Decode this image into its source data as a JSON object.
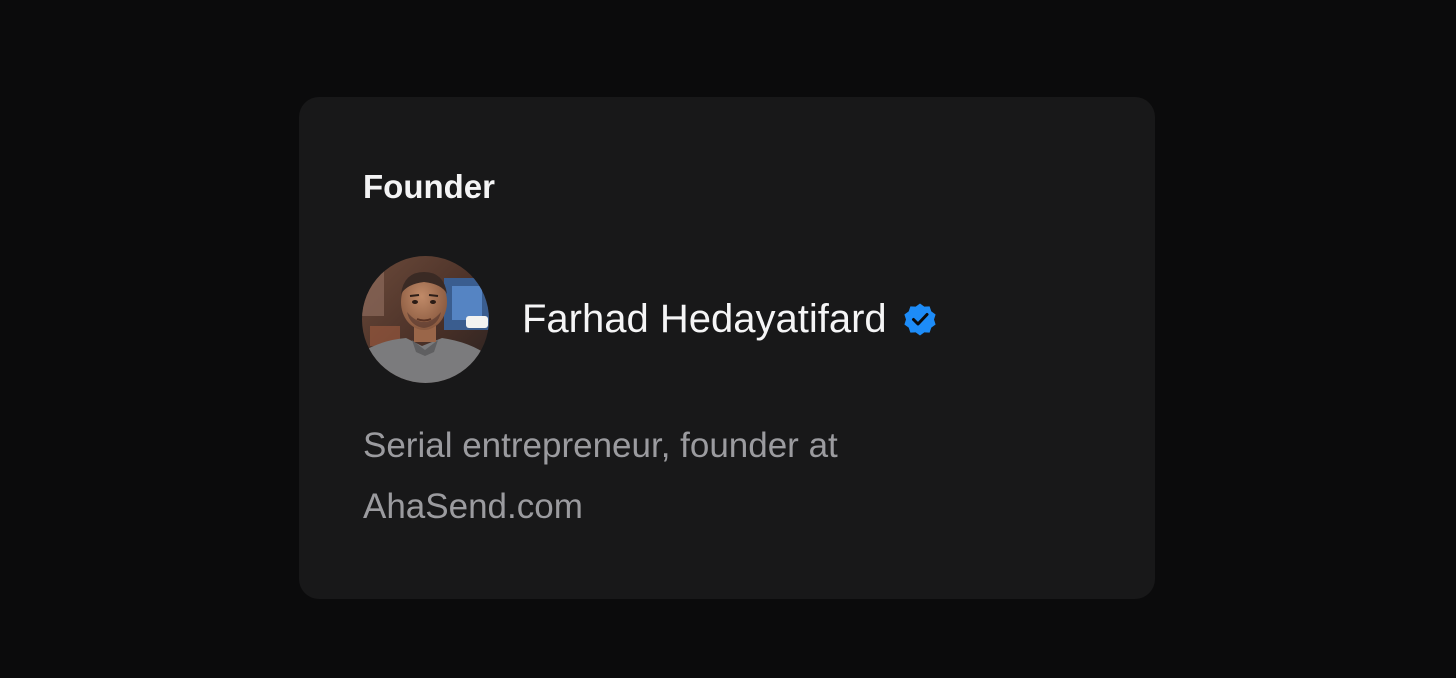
{
  "card": {
    "section_title": "Founder",
    "person": {
      "name": "Farhad Hedayatifard",
      "avatar_icon": "profile-photo",
      "badge_icon": "verified-badge-icon",
      "badge_color": "#1d8cf8"
    },
    "bio": "Serial entrepreneur, founder at AhaSend.com"
  },
  "colors": {
    "page_background": "#0b0b0c",
    "card_background": "#181819",
    "title_text": "#f4f4f5",
    "bio_text": "#9b9b9f"
  }
}
